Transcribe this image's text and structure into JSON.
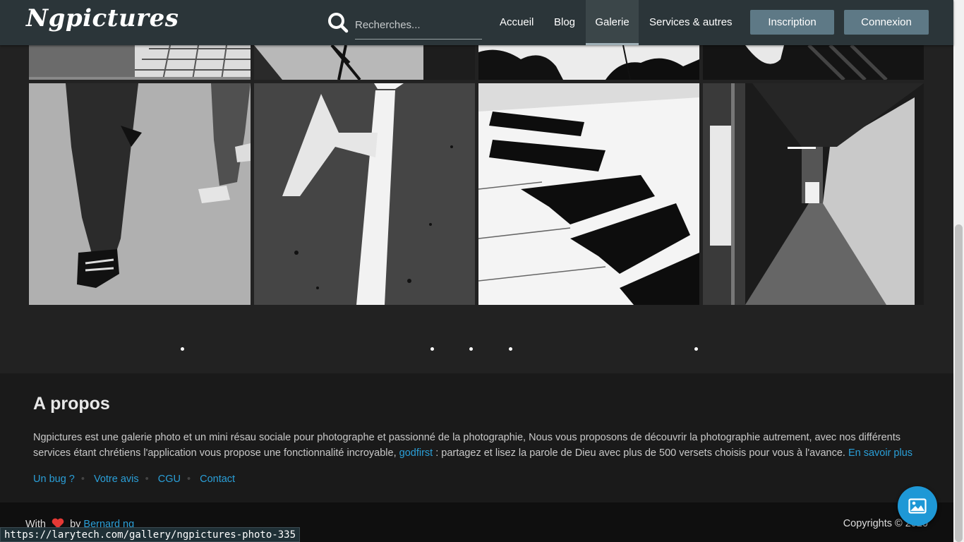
{
  "nav": {
    "logo": "Ngpictures",
    "search_placeholder": "Recherches...",
    "links": [
      "Accueil",
      "Blog",
      "Galerie",
      "Services & autres"
    ],
    "active": "Galerie",
    "signup": "Inscription",
    "login": "Connexion"
  },
  "footer": {
    "about_title": "A propos",
    "about_text_1": "Ngpictures est une galerie photo et un mini résau sociale pour photographe et passionné de la photographie, Nous vous proposons de découvrir la photographie autrement, avec nos différents services étant chrétiens l'application vous propose une fonctionnalité incroyable, ",
    "about_link": "godfirst",
    "about_text_2": " : partagez et lisez la parole de Dieu avec plus de 500 versets choisis pour vous à l'avance. ",
    "about_more": "En savoir plus",
    "links": [
      "Un bug ?",
      "Votre avis",
      "CGU",
      "Contact"
    ],
    "with_text": "With",
    "by_text": "by",
    "author": "Bernard ng",
    "copyright": "Copyrights © 2020"
  },
  "status_url": "https://larytech.com/gallery/ngpictures-photo-335",
  "colors": {
    "navbar": "#2b3539",
    "button": "#5e7986",
    "link": "#2a9fd8",
    "fab": "#1e98d6"
  }
}
